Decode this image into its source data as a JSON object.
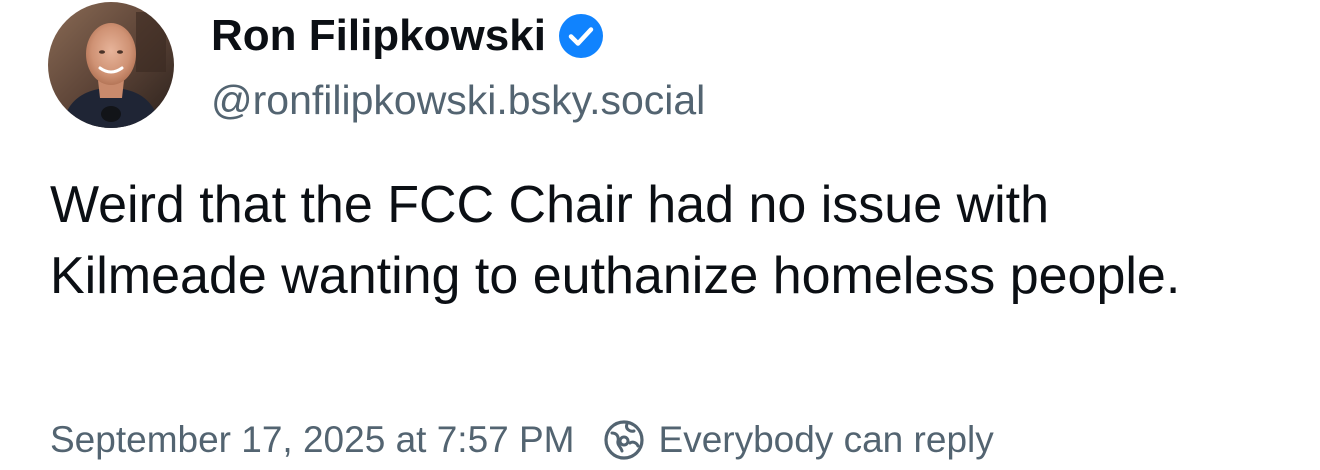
{
  "author": {
    "display_name": "Ron Filipkowski",
    "handle": "@ronfilipkowski.bsky.social",
    "verified": true,
    "avatar_icon": "person-photo-avatar"
  },
  "post": {
    "text": "Weird that the FCC Chair had no issue with Kilmeade wanting to euthanize homeless people."
  },
  "meta": {
    "timestamp": "September 17, 2025 at 7:57 PM",
    "reply_icon": "globe-icon",
    "reply_setting": "Everybody can reply"
  },
  "colors": {
    "text": "#0b0f14",
    "secondary": "#536471",
    "verified_badge": "#1083fe",
    "background": "#ffffff"
  }
}
